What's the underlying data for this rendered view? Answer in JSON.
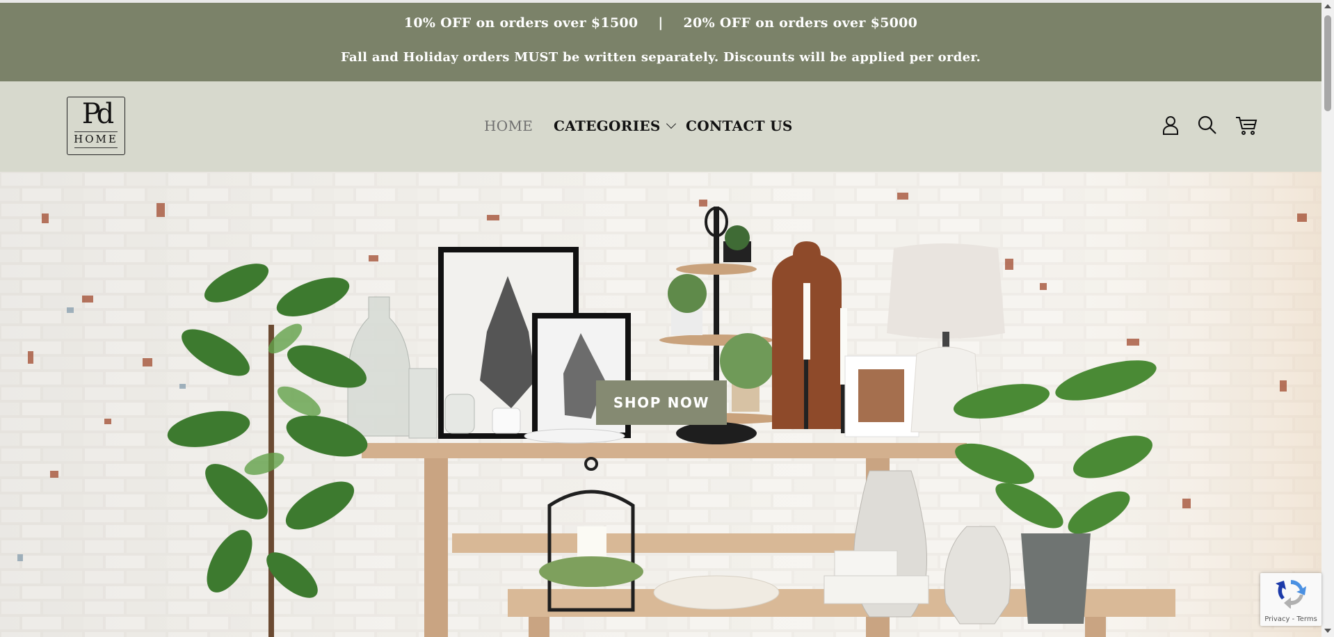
{
  "announcement": {
    "offer_1": "10% OFF on orders over $1500",
    "separator": "|",
    "offer_2": "20% OFF on orders over $5000",
    "notice": "Fall and Holiday orders MUST be written separately. Discounts will be applied per order."
  },
  "logo": {
    "monogram": "Pd",
    "word": "HOME"
  },
  "nav": {
    "home": "HOME",
    "categories": "CATEGORIES",
    "contact": "CONTACT US"
  },
  "header_icons": [
    "user-icon",
    "search-icon",
    "cart-icon"
  ],
  "hero": {
    "button_label": "SHOP NOW"
  },
  "recaptcha": {
    "links": "Privacy - Terms"
  },
  "colors": {
    "announcement_bg": "#7b8269",
    "header_bg": "#d7d9cd",
    "button_bg": "#858a72"
  }
}
